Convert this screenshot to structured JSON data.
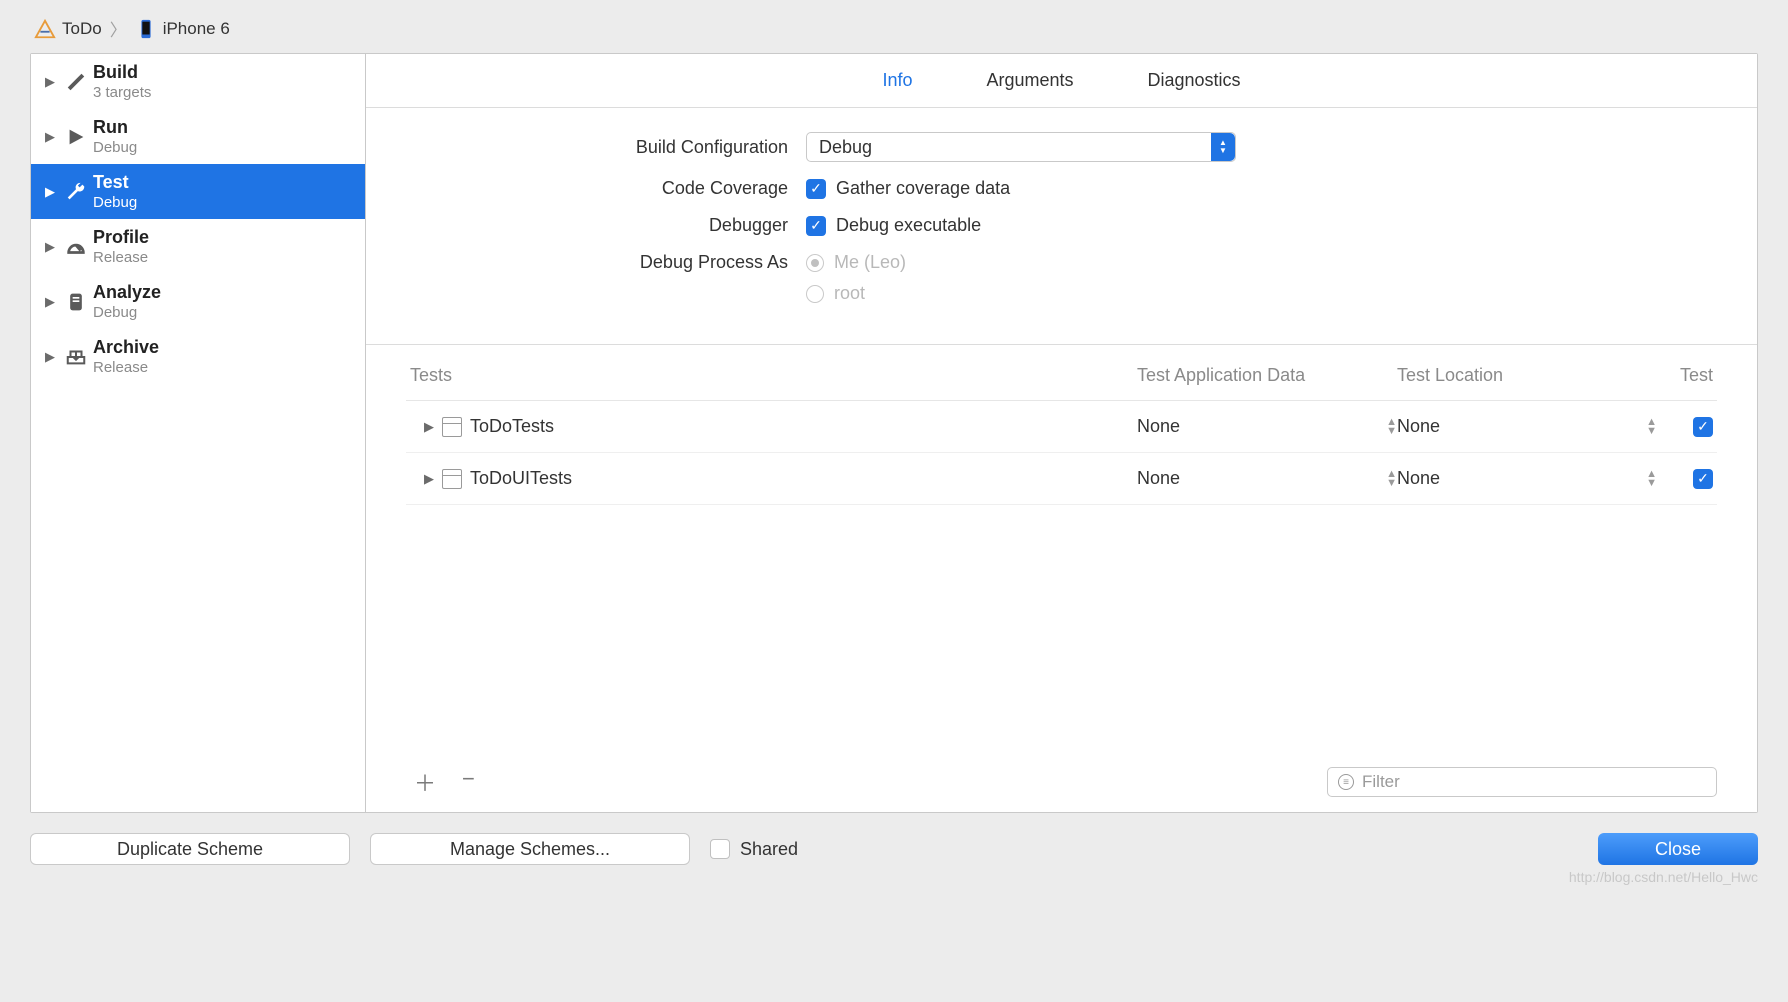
{
  "breadcrumb": {
    "project": "ToDo",
    "device": "iPhone 6"
  },
  "sidebar": {
    "items": [
      {
        "title": "Build",
        "sub": "3 targets"
      },
      {
        "title": "Run",
        "sub": "Debug"
      },
      {
        "title": "Test",
        "sub": "Debug"
      },
      {
        "title": "Profile",
        "sub": "Release"
      },
      {
        "title": "Analyze",
        "sub": "Debug"
      },
      {
        "title": "Archive",
        "sub": "Release"
      }
    ],
    "selected_index": 2
  },
  "tabs": {
    "items": [
      "Info",
      "Arguments",
      "Diagnostics"
    ],
    "active_index": 0
  },
  "form": {
    "build_config_label": "Build Configuration",
    "build_config_value": "Debug",
    "code_coverage_label": "Code Coverage",
    "code_coverage_text": "Gather coverage data",
    "debugger_label": "Debugger",
    "debugger_text": "Debug executable",
    "debug_process_label": "Debug Process As",
    "radio_me": "Me (Leo)",
    "radio_root": "root"
  },
  "tests": {
    "headers": {
      "tests": "Tests",
      "app": "Test Application Data",
      "loc": "Test Location",
      "test": "Test"
    },
    "rows": [
      {
        "name": "ToDoTests",
        "app": "None",
        "loc": "None",
        "checked": true
      },
      {
        "name": "ToDoUITests",
        "app": "None",
        "loc": "None",
        "checked": true
      }
    ],
    "filter_placeholder": "Filter"
  },
  "bottom": {
    "duplicate": "Duplicate Scheme",
    "manage": "Manage Schemes...",
    "shared": "Shared",
    "close": "Close"
  },
  "watermark": "http://blog.csdn.net/Hello_Hwc"
}
